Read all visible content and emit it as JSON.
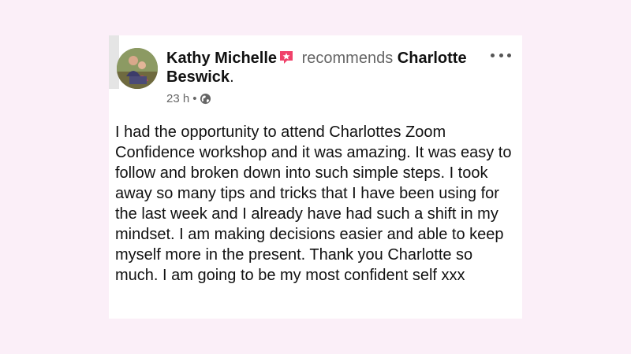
{
  "post": {
    "author": "Kathy Michelle",
    "action": "recommends",
    "recommended_first": "Charlotte",
    "recommended_second": "Beswick",
    "period": ".",
    "time": "23 h",
    "separator": "•",
    "privacy_icon": "globe-icon",
    "badge_icon": "recommendation-star-icon",
    "more_icon": "more-options-icon",
    "badge_color": "#f0426a",
    "text": "I had the opportunity to attend Charlottes Zoom Confidence workshop and it was amazing. It was easy to follow and broken down into such simple steps. I took away so many tips and tricks that I have been using for the last week and I already have had such a shift in my mindset. I am making decisions easier and able to keep myself more in the present. Thank you Charlotte so much. I am going to be my most confident self xxx"
  }
}
